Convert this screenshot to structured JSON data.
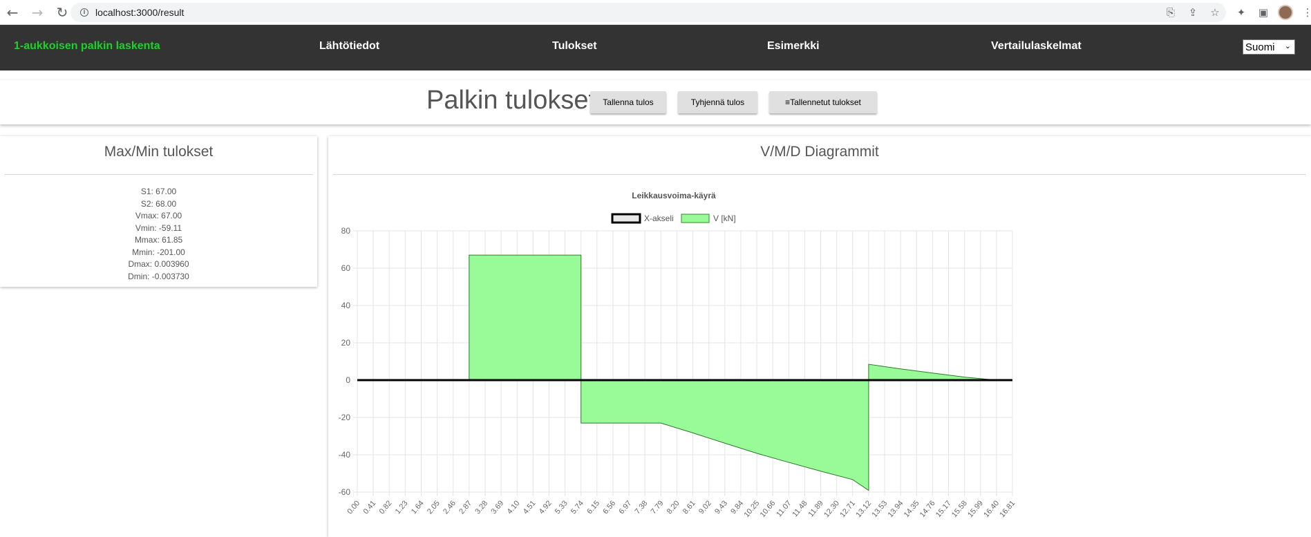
{
  "browser": {
    "url": "localhost:3000/result",
    "back_icon": "←",
    "forward_icon": "→",
    "reload_icon": "↻",
    "info_icon": "i"
  },
  "nav": {
    "brand": "1-aukkoisen palkin laskenta",
    "links": [
      "Lähtötiedot",
      "Tulokset",
      "Esimerkki",
      "Vertailulaskelmat"
    ],
    "language": "Suomi"
  },
  "header": {
    "title": "Palkin tulokset",
    "buttons": [
      "Tallenna tulos",
      "Tyhjennä tulos",
      "≡Tallennetut tulokset"
    ]
  },
  "maxmin": {
    "title": "Max/Min tulokset",
    "lines": [
      "S1: 67.00",
      "S2: 68.00",
      "Vmax: 67.00",
      "Vmin: -59.11",
      "Mmax: 61.85",
      "Mmin: -201.00",
      "Dmax: 0.003960",
      "Dmin: -0.003730"
    ]
  },
  "diagrams": {
    "title": "V/M/D Diagrammit"
  },
  "colors": {
    "brand": "#1ed12a",
    "nav_bg": "#333333",
    "area_fill": "#98fb98"
  },
  "chart_data": {
    "type": "area",
    "title": "Leikkausvoima-käyrä",
    "legend": [
      "X-akseli",
      "V [kN]"
    ],
    "legend_position": "top",
    "grid": true,
    "ylim": [
      -60,
      80
    ],
    "yticks": [
      80,
      60,
      40,
      20,
      0,
      -20,
      -40,
      -60
    ],
    "xticks": [
      "0.00",
      "0.41",
      "0.82",
      "1.23",
      "1.64",
      "2.05",
      "2.46",
      "2.87",
      "3.28",
      "3.69",
      "4.10",
      "4.51",
      "4.92",
      "5.33",
      "5.74",
      "6.15",
      "6.56",
      "6.97",
      "7.38",
      "7.79",
      "8.20",
      "8.61",
      "9.02",
      "9.43",
      "9.84",
      "10.25",
      "10.66",
      "11.07",
      "11.48",
      "11.89",
      "12.30",
      "12.71",
      "13.12",
      "13.53",
      "13.94",
      "14.35",
      "14.76",
      "15.17",
      "15.58",
      "15.99",
      "16.40",
      "16.81"
    ],
    "series": [
      {
        "name": "V [kN]",
        "points": [
          [
            0,
            0
          ],
          [
            2.87,
            0
          ],
          [
            2.87,
            67
          ],
          [
            5.74,
            67
          ],
          [
            5.74,
            -23
          ],
          [
            7.79,
            -23
          ],
          [
            8.61,
            -28.3
          ],
          [
            9.43,
            -33.8
          ],
          [
            10.25,
            -39.2
          ],
          [
            11.07,
            -44.1
          ],
          [
            11.89,
            -48.8
          ],
          [
            12.71,
            -53.3
          ],
          [
            13.12,
            -59.11
          ],
          [
            13.12,
            8.5
          ],
          [
            13.94,
            6.0
          ],
          [
            14.76,
            3.8
          ],
          [
            15.58,
            1.6
          ],
          [
            16.4,
            0
          ],
          [
            16.81,
            0
          ]
        ]
      },
      {
        "name": "X-akseli",
        "points": [
          [
            0,
            0
          ],
          [
            16.81,
            0
          ]
        ]
      }
    ]
  }
}
